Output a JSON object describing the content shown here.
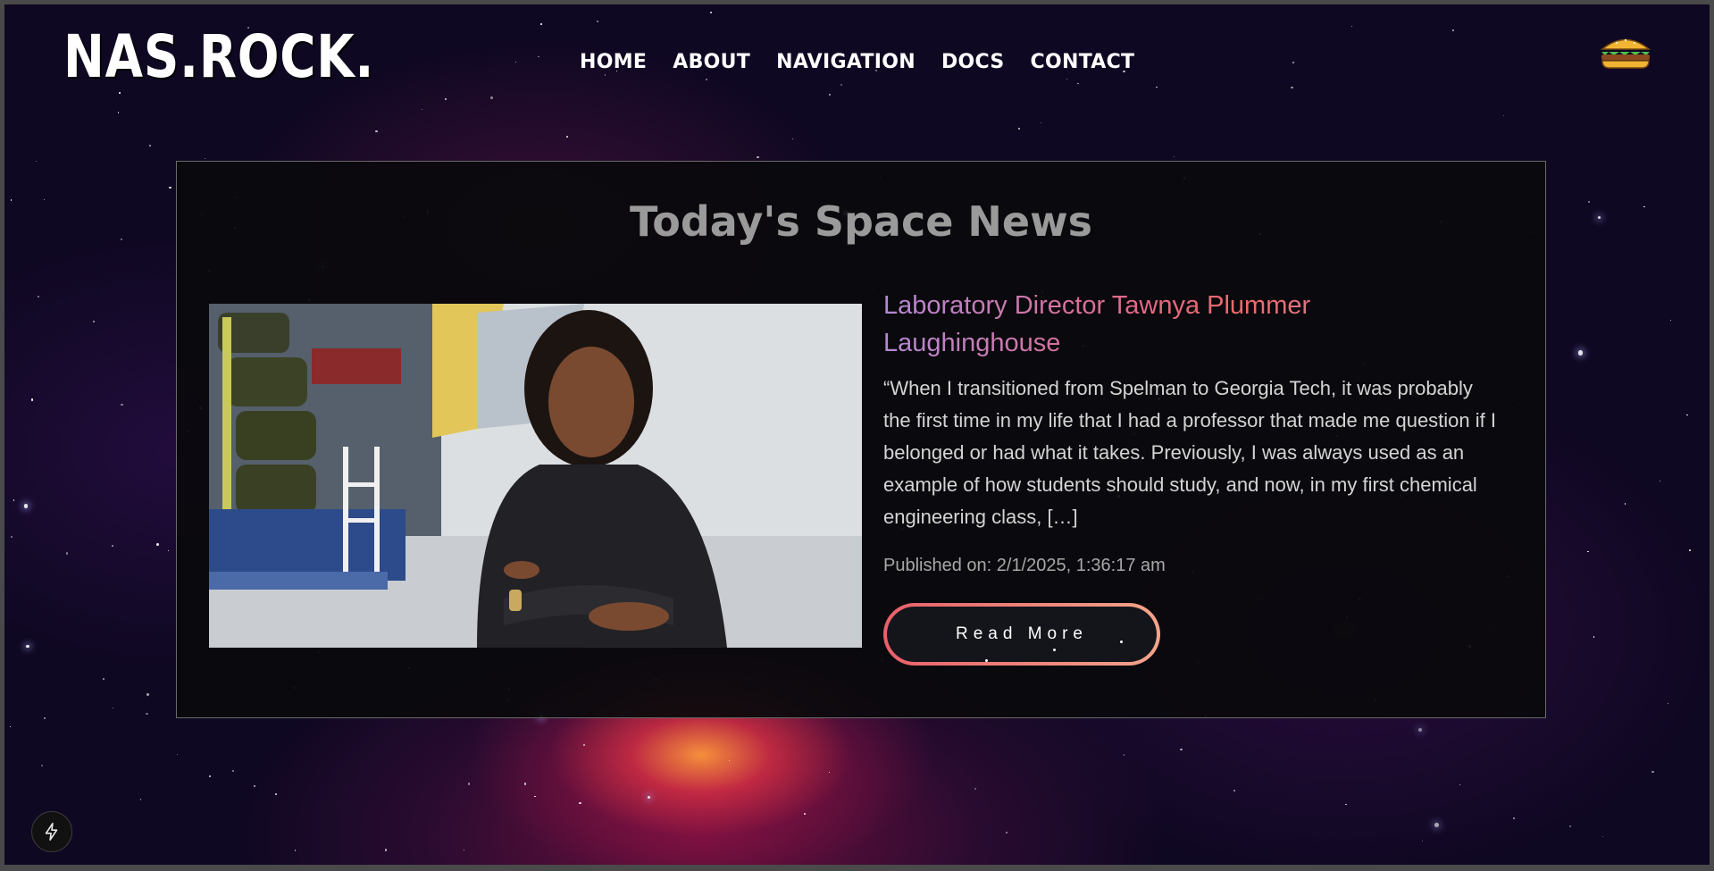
{
  "header": {
    "logo": "NAS.ROCK.",
    "nav": [
      "HOME",
      "ABOUT",
      "NAVIGATION",
      "DOCS",
      "CONTACT"
    ],
    "menu_icon": "hamburger-food-icon"
  },
  "news": {
    "heading": "Today's Space News",
    "article": {
      "title": "Laboratory Director Tawnya Plummer Laughinghouse",
      "excerpt": "“When I transitioned from Spelman to Georgia Tech, it was probably the first time in my life that I had a professor that made me question if I belonged or had what it takes. Previously, I was always used as an example of how students should study, and now, in my first chemical engineering class, […]",
      "published": "Published on: 2/1/2025, 1:36:17 am",
      "button": "Read More"
    }
  },
  "footer_badge_icon": "lightning-bolt-icon",
  "colors": {
    "title_gradient": [
      "#b489d6",
      "#f06a6a"
    ],
    "button_border": [
      "#e8606a",
      "#f3a58a"
    ],
    "card_bg": "#0a0a0c"
  }
}
